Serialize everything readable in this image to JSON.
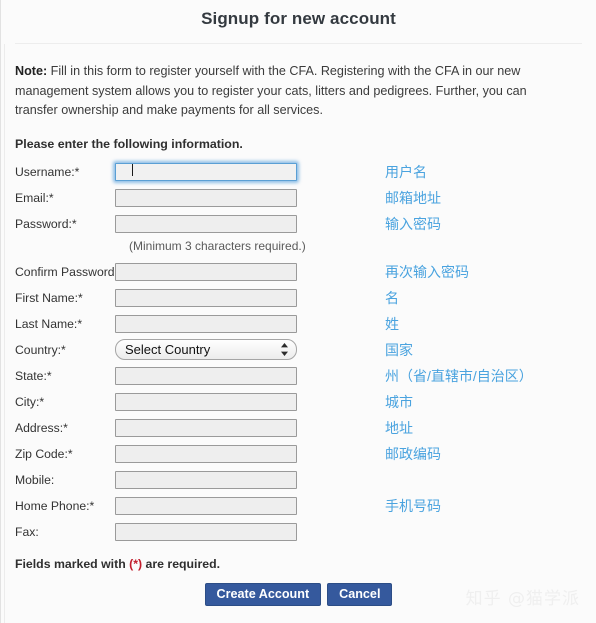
{
  "header": {
    "title": "Signup for new account"
  },
  "note": {
    "prefix": "Note:",
    "text": " Fill in this form to register yourself with the CFA. Registering with the CFA in our new management system allows you to register your cats, litters and pedigrees. Further, you can transfer ownership and make payments for all services."
  },
  "subhead": "Please enter the following information.",
  "form": {
    "password_hint": "(Minimum 3 characters required.)",
    "country_selected": "Select Country",
    "country_options": [
      "Select Country"
    ],
    "fields": [
      {
        "label": "Username:*",
        "value": "",
        "placeholder": "",
        "type": "text",
        "focused": true,
        "annotation": "用户名"
      },
      {
        "label": "Email:*",
        "value": "",
        "placeholder": "",
        "type": "text",
        "focused": false,
        "annotation": "邮箱地址"
      },
      {
        "label": "Password:*",
        "value": "",
        "placeholder": "",
        "type": "text",
        "focused": false,
        "annotation": "输入密码"
      },
      {
        "label": "Confirm Password:*",
        "value": "",
        "placeholder": "",
        "type": "text",
        "focused": false,
        "annotation": "再次输入密码"
      },
      {
        "label": "First Name:*",
        "value": "",
        "placeholder": "",
        "type": "text",
        "focused": false,
        "annotation": "名"
      },
      {
        "label": "Last Name:*",
        "value": "",
        "placeholder": "",
        "type": "text",
        "focused": false,
        "annotation": "姓"
      },
      {
        "label": "Country:*",
        "value": "Select Country",
        "placeholder": "",
        "type": "select",
        "focused": false,
        "annotation": "国家"
      },
      {
        "label": "State:*",
        "value": "",
        "placeholder": "",
        "type": "text",
        "focused": false,
        "annotation": "州（省/直辖市/自治区）"
      },
      {
        "label": "City:*",
        "value": "",
        "placeholder": "",
        "type": "text",
        "focused": false,
        "annotation": "城市"
      },
      {
        "label": "Address:*",
        "value": "",
        "placeholder": "",
        "type": "text",
        "focused": false,
        "annotation": "地址"
      },
      {
        "label": "Zip Code:*",
        "value": "",
        "placeholder": "",
        "type": "text",
        "focused": false,
        "annotation": "邮政编码"
      },
      {
        "label": "Mobile:",
        "value": "",
        "placeholder": "",
        "type": "text",
        "focused": false,
        "annotation": ""
      },
      {
        "label": "Home Phone:*",
        "value": "",
        "placeholder": "",
        "type": "text",
        "focused": false,
        "annotation": "手机号码"
      },
      {
        "label": "Fax:",
        "value": "",
        "placeholder": "",
        "type": "text",
        "focused": false,
        "annotation": ""
      }
    ]
  },
  "footer": {
    "required_prefix": "Fields marked with ",
    "required_star": "(*)",
    "required_suffix": " are required.",
    "create_label": "Create Account",
    "cancel_label": "Cancel"
  },
  "watermark": "知乎 @猫学派",
  "colors": {
    "accent_blue": "#4aa3df",
    "button_blue": "#35599d",
    "required_red": "#c21d2c",
    "focus_ring": "#6aaadf"
  }
}
